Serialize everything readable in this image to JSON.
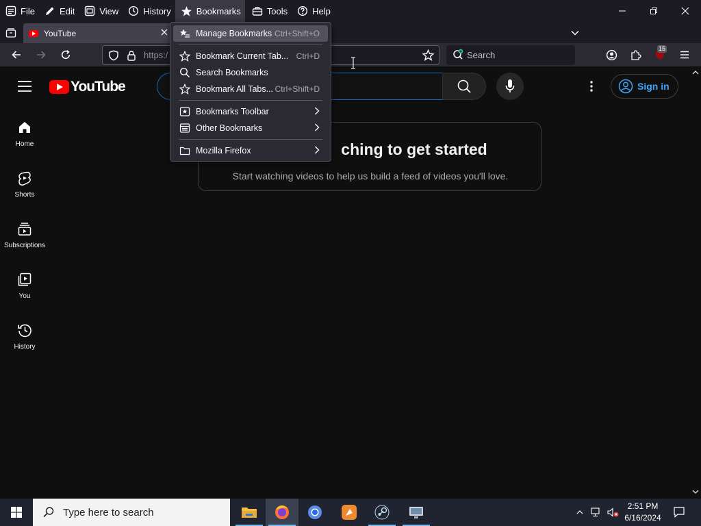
{
  "menubar": {
    "items": [
      "File",
      "Edit",
      "View",
      "History",
      "Bookmarks",
      "Tools",
      "Help"
    ],
    "active": "Bookmarks"
  },
  "tab": {
    "title": "YouTube"
  },
  "urlbar": {
    "text": "https:/"
  },
  "searchbar": {
    "placeholder": "Search"
  },
  "extension_badge": "15",
  "bookmarks_menu": {
    "items": [
      {
        "label": "Manage Bookmarks",
        "shortcut": "Ctrl+Shift+O",
        "icon": "star-list-icon"
      },
      {
        "label": "Bookmark Current Tab...",
        "shortcut": "Ctrl+D",
        "icon": "star-outline-icon"
      },
      {
        "label": "Search Bookmarks",
        "shortcut": "",
        "icon": "search-icon"
      },
      {
        "label": "Bookmark All Tabs...",
        "shortcut": "Ctrl+Shift+D",
        "icon": "star-outline-icon"
      },
      {
        "label": "Bookmarks Toolbar",
        "shortcut": "",
        "icon": "bookmarks-toolbar-icon",
        "submenu": true
      },
      {
        "label": "Other Bookmarks",
        "shortcut": "",
        "icon": "folder-list-icon",
        "submenu": true
      },
      {
        "label": "Mozilla Firefox",
        "shortcut": "",
        "icon": "folder-icon",
        "submenu": true
      }
    ]
  },
  "youtube": {
    "logo_text": "YouTube",
    "sign_in": "Sign in",
    "sidebar": [
      {
        "label": "Home",
        "icon": "home-icon"
      },
      {
        "label": "Shorts",
        "icon": "shorts-icon"
      },
      {
        "label": "Subscriptions",
        "icon": "subscriptions-icon"
      },
      {
        "label": "You",
        "icon": "you-icon"
      },
      {
        "label": "History",
        "icon": "history-icon"
      }
    ],
    "card_title": "Try searching to get started",
    "card_title_visible": "ching to get started",
    "card_subtitle": "Start watching videos to help us build a feed of videos you'll love."
  },
  "taskbar": {
    "search_placeholder": "Type here to search",
    "time": "2:51 PM",
    "date": "6/16/2024"
  },
  "colors": {
    "accent_blue": "#3ea6ff",
    "youtube_red": "#ff0000",
    "menu_bg": "#2b2a33",
    "page_bg": "#0f0f0f"
  }
}
